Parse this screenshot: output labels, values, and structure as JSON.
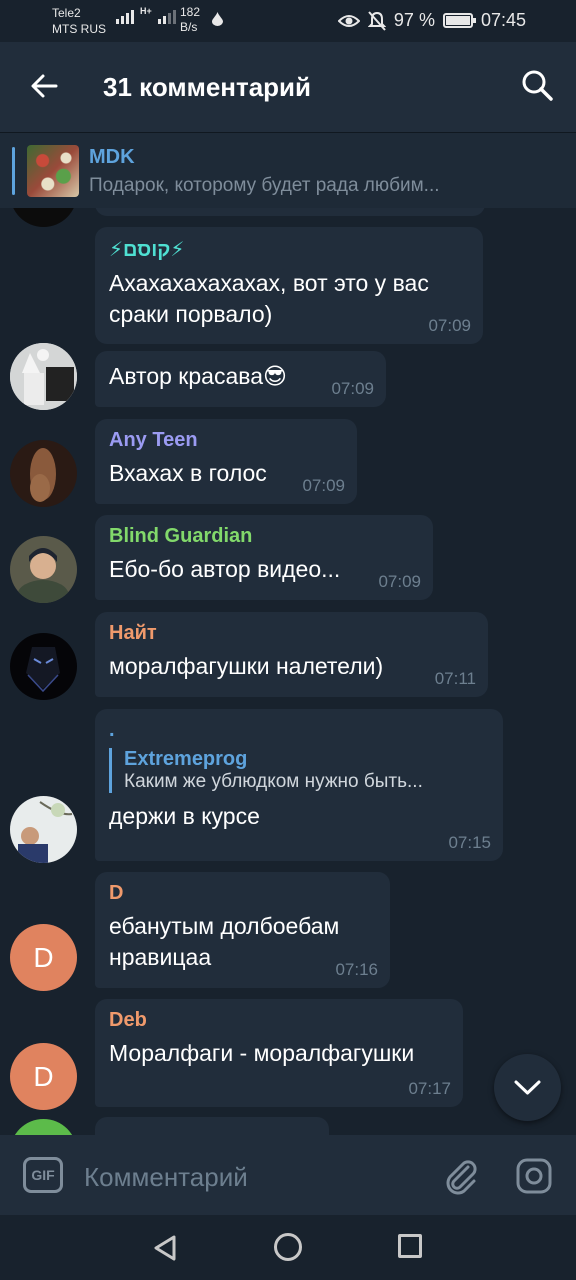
{
  "status_bar": {
    "carrier1": "Tele2",
    "carrier2": "MTS RUS",
    "net_type": "H+",
    "speed_value": "182",
    "speed_unit": "B/s",
    "battery": "97 %",
    "time": "07:45"
  },
  "header": {
    "title": "31 комментарий"
  },
  "pinned": {
    "title": "MDK",
    "text": "Подарок, которому будет рада любим..."
  },
  "messages": [
    {
      "author": "⚡קוסם⚡",
      "author_color": "#4fe0d2",
      "text": "Ахахахахахахах, вот это у вас сраки порвало)",
      "time": "07:09"
    },
    {
      "author": "",
      "text": "Автор красава😎",
      "time": "07:09"
    },
    {
      "author": "Any Teen",
      "author_color": "#9b9bf2",
      "text": "Вхахах в голос",
      "time": "07:09"
    },
    {
      "author": "Blind Guardian",
      "author_color": "#82d96b",
      "text": "Ебо-бо автор видео...",
      "time": "07:09"
    },
    {
      "author": "Найт",
      "author_color": "#f09a6c",
      "text": "моралфагушки налетели)",
      "time": "07:11"
    },
    {
      "author": ".",
      "author_color": "#5ea3dd",
      "reply_name": "Extremeprog",
      "reply_text": "Каким же ублюдком нужно быть...",
      "text": "держи в курсе",
      "time": "07:15"
    },
    {
      "author": "D",
      "author_color": "#f09a6c",
      "avatar_letter": "D",
      "text": "ебанутым долбоебам нравицаа",
      "time": "07:16"
    },
    {
      "author": "Deb",
      "author_color": "#f09a6c",
      "avatar_letter": "D",
      "text": "Моралфаги - моралфагушки",
      "time": "07:17"
    }
  ],
  "input": {
    "gif_label": "GIF",
    "placeholder": "Комментарий"
  },
  "colors": {
    "background": "#18222d",
    "bubble": "#212d3b",
    "accent": "#5ea3dd"
  }
}
